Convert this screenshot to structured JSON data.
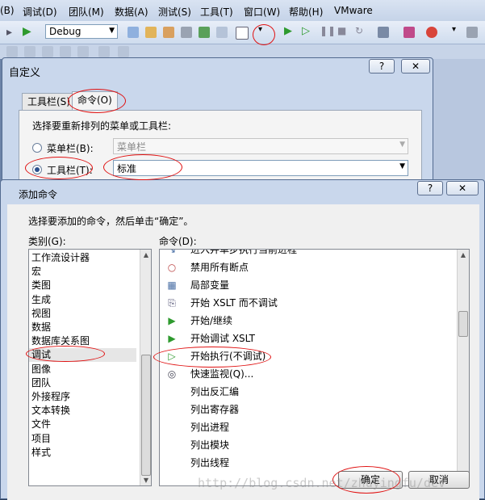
{
  "menubar": {
    "items": [
      "(B)",
      "调试(D)",
      "团队(M)",
      "数据(A)",
      "测试(S)",
      "工具(T)",
      "窗口(W)",
      "帮助(H)",
      "VMware"
    ]
  },
  "toolbar": {
    "config_value": "Debug"
  },
  "customize_dialog": {
    "title": "自定义",
    "help_btn": "?",
    "close_btn": "✕",
    "tabs": [
      "工具栏(S)",
      "命令(O)"
    ],
    "prompt": "选择要重新排列的菜单或工具栏:",
    "menubar_option": {
      "label": "菜单栏(B):",
      "value": "菜单栏"
    },
    "toolbar_option": {
      "label": "工具栏(T):",
      "value": "标准"
    }
  },
  "add_command_dialog": {
    "title": "添加命令",
    "help_btn": "?",
    "close_btn": "✕",
    "instruction": "选择要添加的命令，然后单击“确定”。",
    "category_label": "类别(G):",
    "command_label": "命令(D):",
    "categories": [
      "工作流设计器",
      "宏",
      "类图",
      "生成",
      "视图",
      "数据",
      "数据库关系图",
      "调试",
      "图像",
      "团队",
      "外接程序",
      "文本转换",
      "文件",
      "项目",
      "样式"
    ],
    "selected_category": "调试",
    "commands": [
      {
        "label": "进入并单步执行当前进程",
        "icon": "step-into-icon"
      },
      {
        "label": "禁用所有断点",
        "icon": "disable-breakpoints-icon"
      },
      {
        "label": "局部变量",
        "icon": "locals-window-icon"
      },
      {
        "label": "开始 XSLT 而不调试",
        "icon": "xslt-no-debug-icon"
      },
      {
        "label": "开始/继续",
        "icon": "start-continue-icon"
      },
      {
        "label": "开始调试 XSLT",
        "icon": "xslt-debug-icon"
      },
      {
        "label": "开始执行(不调试)",
        "icon": "start-without-debugging-icon"
      },
      {
        "label": "快速监视(Q)...",
        "icon": "quick-watch-icon"
      },
      {
        "label": "列出反汇编",
        "icon": ""
      },
      {
        "label": "列出寄存器",
        "icon": ""
      },
      {
        "label": "列出进程",
        "icon": ""
      },
      {
        "label": "列出模块",
        "icon": ""
      },
      {
        "label": "列出线程",
        "icon": ""
      }
    ],
    "ok_button": "确定",
    "cancel_button": "取消"
  },
  "watermark": "http://blog.csdn.net/zhuyingfu/dev",
  "colors": {
    "annotation_red": "#e01010",
    "play_green": "#2e9a2e"
  }
}
